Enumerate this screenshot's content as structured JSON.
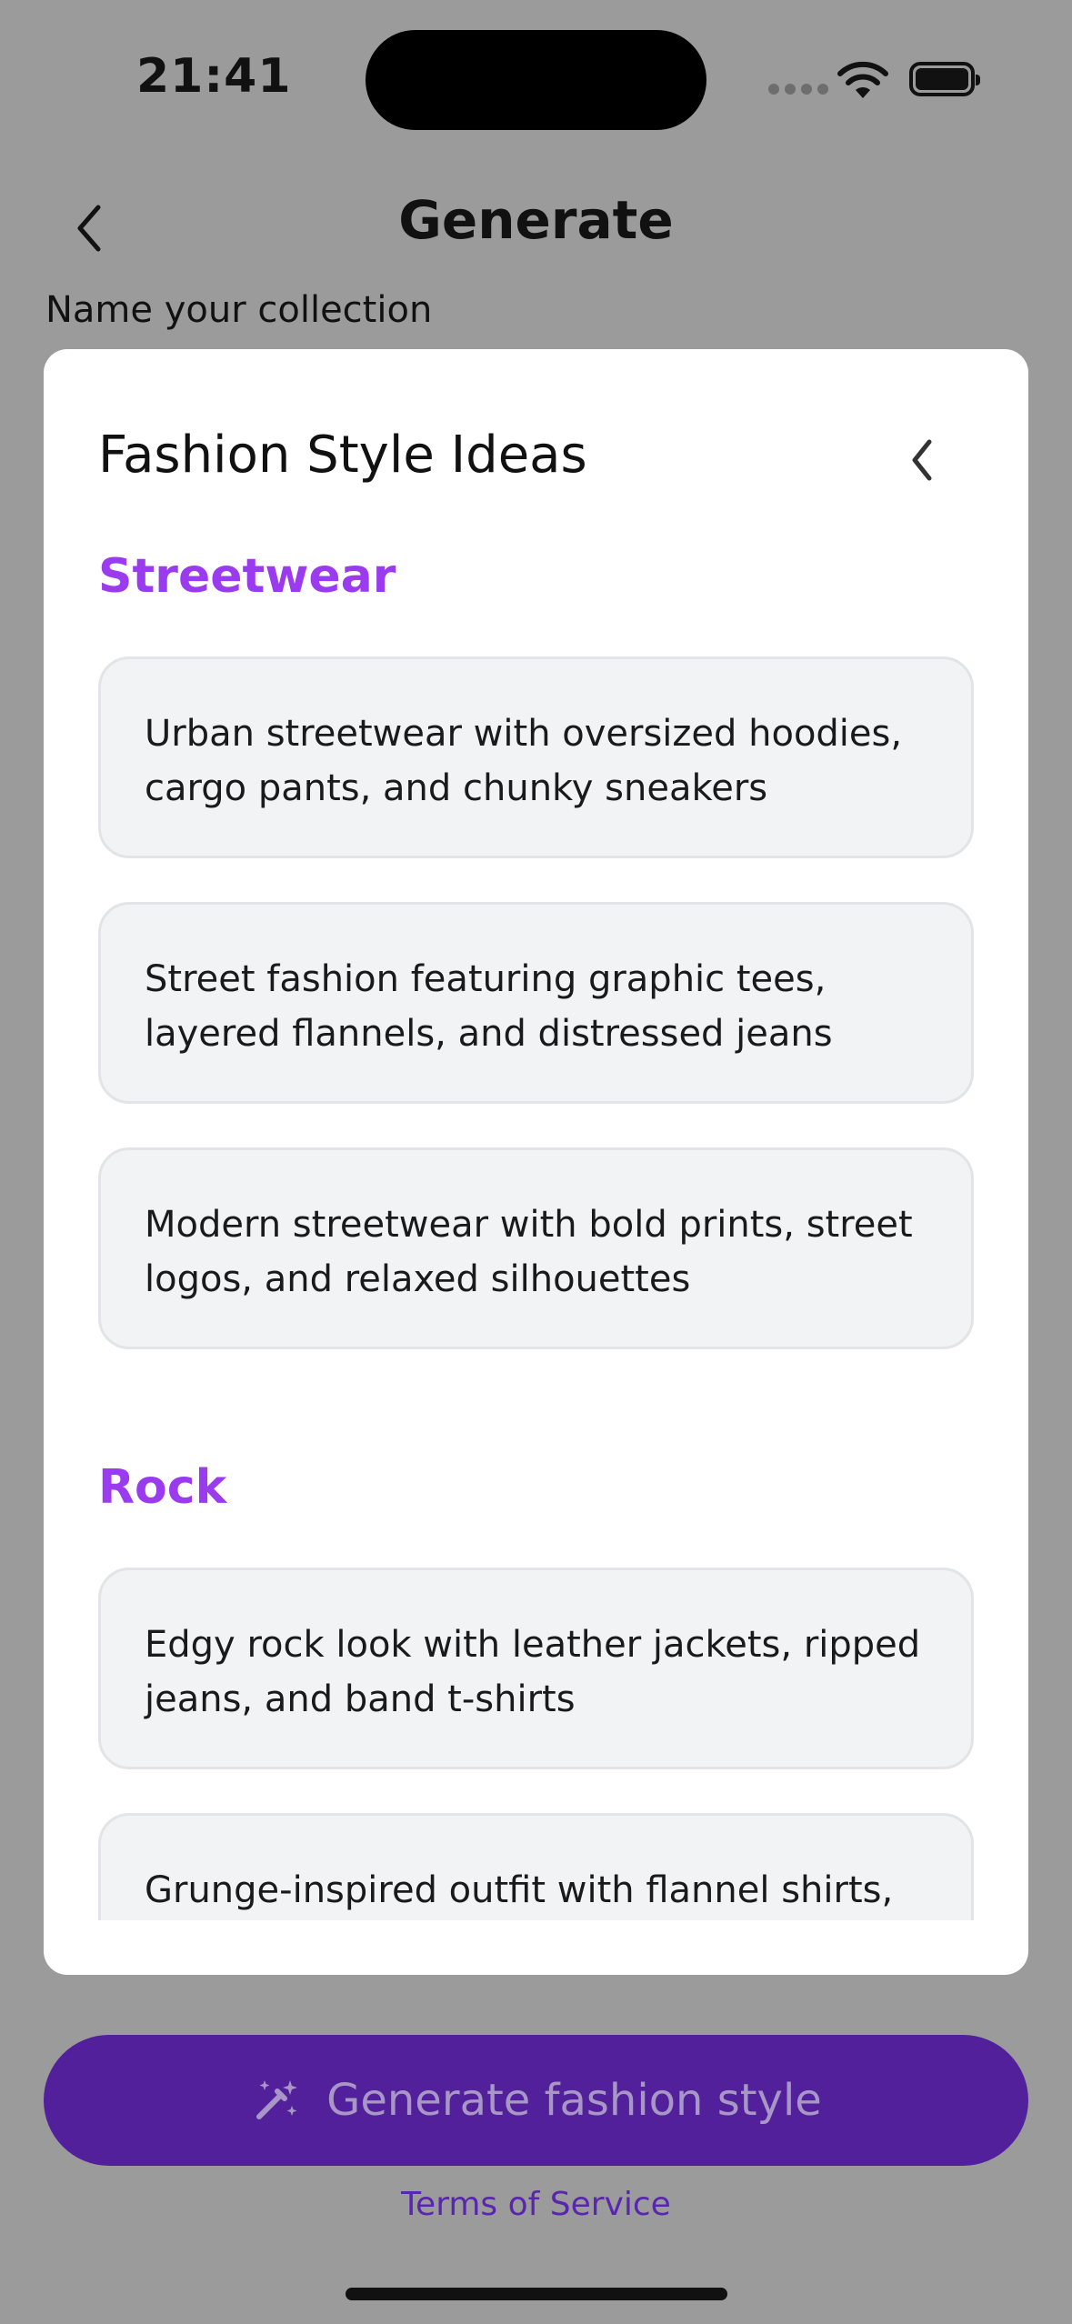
{
  "status_bar": {
    "time": "21:41"
  },
  "header": {
    "title": "Generate",
    "back_icon": "chevron-left-icon"
  },
  "form": {
    "name_label": "Name your collection"
  },
  "sheet": {
    "title": "Fashion Style Ideas",
    "collapse_icon": "chevron-left-icon",
    "sections": [
      {
        "title": "Streetwear",
        "ideas": [
          "Urban streetwear with oversized hoodies, cargo pants, and chunky sneakers",
          "Street fashion featuring graphic tees, layered flannels, and distressed jeans",
          "Modern streetwear with bold prints, street logos, and relaxed silhouettes"
        ]
      },
      {
        "title": "Rock",
        "ideas": [
          "Edgy rock look with leather jackets, ripped jeans, and band t-shirts",
          "Grunge-inspired outfit with flannel shirts,"
        ]
      }
    ]
  },
  "actions": {
    "generate_label": "Generate fashion style",
    "generate_icon": "magic-wand-icon",
    "terms_label": "Terms of Service"
  },
  "colors": {
    "accent_purple": "#9b3bf0",
    "button_purple": "#52209a",
    "overlay_gray": "#9b9b9b"
  }
}
